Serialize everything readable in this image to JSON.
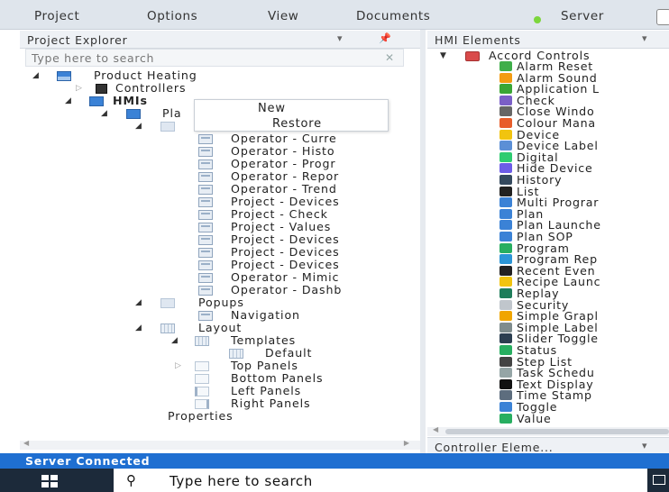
{
  "menu": [
    "Project",
    "Options",
    "View",
    "Documents",
    "Server"
  ],
  "project_explorer": {
    "title": "Project Explorer",
    "search_placeholder": "Type here to search",
    "tree": [
      {
        "label": "Product Heating"
      },
      {
        "label": "Controllers"
      },
      {
        "label": "HMIs"
      },
      {
        "label": "Pla"
      },
      {
        "label": ""
      },
      {
        "label": "Operator - Curre"
      },
      {
        "label": "Operator - Histo"
      },
      {
        "label": "Operator - Progr"
      },
      {
        "label": "Operator - Repor"
      },
      {
        "label": "Operator - Trend"
      },
      {
        "label": "Project - Devices"
      },
      {
        "label": "Project - Check"
      },
      {
        "label": "Project - Values"
      },
      {
        "label": "Project - Devices"
      },
      {
        "label": "Project - Devices"
      },
      {
        "label": "Project - Devices"
      },
      {
        "label": "Operator - Mimic"
      },
      {
        "label": "Operator - Dashb"
      },
      {
        "label": "Popups"
      },
      {
        "label": "Navigation"
      },
      {
        "label": "Layout"
      },
      {
        "label": "Templates"
      },
      {
        "label": "Default"
      },
      {
        "label": "Top Panels"
      },
      {
        "label": "Bottom Panels"
      },
      {
        "label": "Left Panels"
      },
      {
        "label": "Right Panels"
      },
      {
        "label": "Properties"
      }
    ]
  },
  "context_menu": {
    "items": [
      "New",
      "Restore"
    ]
  },
  "hmi_elements": {
    "title": "HMI Elements",
    "group": "Accord Controls",
    "items": [
      "Alarm Reset",
      "Alarm Sound",
      "Application L",
      "Check",
      "Close Windo",
      "Colour Mana",
      "Device",
      "Device Label",
      "Digital",
      "Hide Device",
      "History",
      "List",
      "Multi Prograr",
      "Plan",
      "Plan Launche",
      "Plan SOP",
      "Program",
      "Program Rep",
      "Recent Even",
      "Recipe Launc",
      "Replay",
      "Security",
      "Simple Grapl",
      "Simple Label",
      "Slider Toggle",
      "Status",
      "Step List",
      "Task Schedu",
      "Text Display",
      "Time Stamp",
      "Toggle",
      "Value"
    ],
    "icon_colors": [
      "#3fae49",
      "#f39c12",
      "#3aa635",
      "#7b5fc7",
      "#666666",
      "#e85d2a",
      "#f1c40f",
      "#5b8fd6",
      "#2ecc71",
      "#6c5ce7",
      "#34495e",
      "#222222",
      "#3b82d6",
      "#3b82d6",
      "#3b82d6",
      "#3b82d6",
      "#27ae60",
      "#2b95d6",
      "#222222",
      "#f1c40f",
      "#1e7d5a",
      "#c0c6cc",
      "#f0a500",
      "#7f8c8d",
      "#2c3e50",
      "#27ae60",
      "#444444",
      "#95a5a6",
      "#111111",
      "#5d6d7e",
      "#3b82d6",
      "#27ae60"
    ]
  },
  "controller_elements": {
    "title": "Controller Eleme..."
  },
  "status": {
    "text": "Server Connected"
  },
  "taskbar": {
    "search_placeholder": "Type here to search"
  },
  "icons": {
    "search": "magnifier-icon",
    "start": "windows-start-icon"
  }
}
